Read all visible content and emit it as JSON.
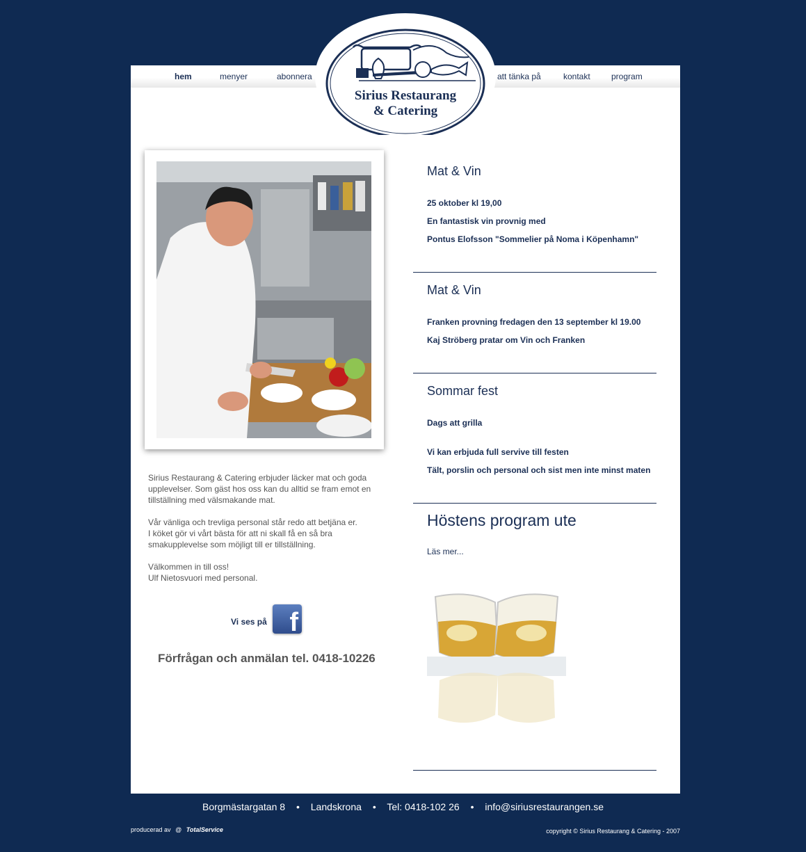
{
  "nav": {
    "left": [
      "hem",
      "menyer",
      "abonnera"
    ],
    "right": [
      "att tänka på",
      "kontakt",
      "program"
    ],
    "active": "hem"
  },
  "logo": {
    "line1": "Sirius Restaurang",
    "line2": "& Catering"
  },
  "intro": {
    "p1": "Sirius Restaurang & Catering erbjuder läcker mat och goda upplevelser. Som gäst hos oss kan du alltid se fram emot en tillställning med välsmakande mat.",
    "p2a": "Vår vänliga och trevliga personal står redo att betjäna er.",
    "p2b": "I köket gör vi vårt bästa för att ni skall få en så bra smakupplevelse som möjligt till er tillställning.",
    "p3a": "Välkommen in till oss!",
    "p3b": "Ulf Nietosvuori med personal."
  },
  "facebook": {
    "label": "Vi ses på",
    "icon": "facebook-icon"
  },
  "contact_line": "Förfrågan och anmälan tel. 0418-10226",
  "news": [
    {
      "title": "Mat & Vin",
      "lines": [
        "25 oktober kl 19,00",
        "En fantastisk vin provnig med",
        "Pontus Elofsson \"Sommelier på Noma i Köpenhamn\""
      ]
    },
    {
      "title": "Mat & Vin",
      "lines": [
        "Franken provning fredagen den 13 september kl 19.00",
        "Kaj Ströberg pratar om Vin och Franken"
      ]
    },
    {
      "title": "Sommar fest",
      "lines": [
        "Dags att grilla",
        "Vi kan erbjuda full servive till festen",
        "Tält, porslin och personal och sist men inte minst maten"
      ]
    },
    {
      "title": "Höstens program ute",
      "link": "Läs mer..."
    }
  ],
  "footer": {
    "street": "Borgmästargatan 8",
    "city": "Landskrona",
    "phone": "Tel: 0418-102 26",
    "email": "info@siriusrestaurangen.se",
    "bullet": "•",
    "produced_by": "producerad av",
    "producer": "TotalService",
    "copyright": "copyright © Sirius Restaurang & Catering - 2007"
  },
  "colors": {
    "background": "#0f2a52",
    "text_navy": "#1b2f55",
    "text_gray": "#555555"
  }
}
